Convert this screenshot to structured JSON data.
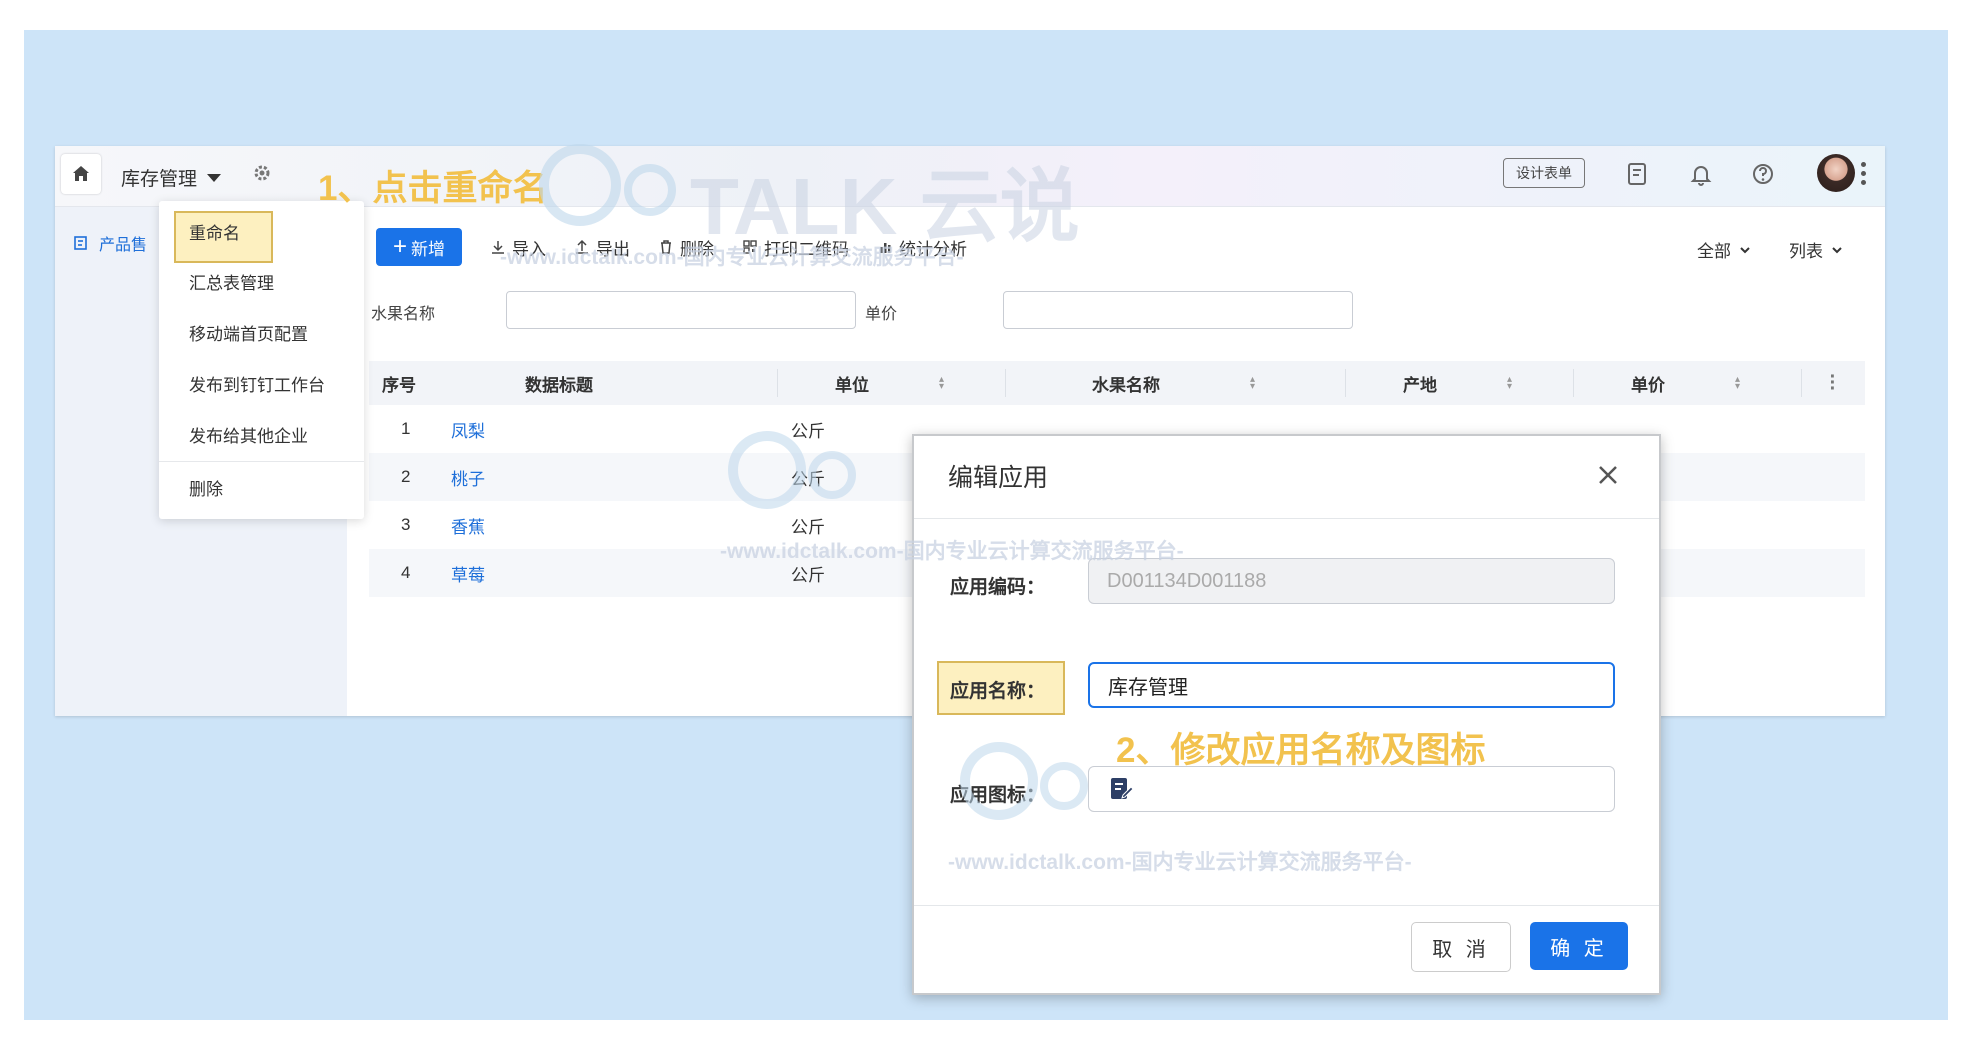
{
  "topbar": {
    "app_title": "库存管理",
    "design_form": "设计表单"
  },
  "sidebar": {
    "item_label": "产品售"
  },
  "toolbar": {
    "add": "新增",
    "import": "导入",
    "export": "导出",
    "delete": "删除",
    "print_qr": "打印二维码",
    "stats": "统计分析",
    "scope": "全部",
    "view": "列表"
  },
  "filters": {
    "fruit_name_label": "水果名称",
    "unit_price_label": "单价"
  },
  "table": {
    "headers": [
      "序号",
      "数据标题",
      "单位",
      "水果名称",
      "产地",
      "单价"
    ],
    "rows": [
      {
        "no": "1",
        "title": "凤梨",
        "unit": "公斤"
      },
      {
        "no": "2",
        "title": "桃子",
        "unit": "公斤"
      },
      {
        "no": "3",
        "title": "香蕉",
        "unit": "公斤"
      },
      {
        "no": "4",
        "title": "草莓",
        "unit": "公斤"
      }
    ]
  },
  "dropdown": {
    "items": [
      "重命名",
      "汇总表管理",
      "移动端首页配置",
      "发布到钉钉工作台",
      "发布给其他企业",
      "删除"
    ]
  },
  "annotations": {
    "step1": "1、点击重命名",
    "step2": "2、修改应用名称及图标"
  },
  "modal": {
    "title": "编辑应用",
    "code_label": "应用编码：",
    "code_value": "D001134D001188",
    "name_label": "应用名称：",
    "name_value": "库存管理",
    "icon_label": "应用图标：",
    "cancel": "取 消",
    "ok": "确 定"
  },
  "watermark": {
    "brand": "TALK 云说",
    "url": "-www.idctalk.com-国内专业云计算交流服务平台-"
  },
  "colors": {
    "primary": "#1a73e8",
    "annotation": "#f2c24e",
    "stage_bg": "#cde4f8"
  }
}
